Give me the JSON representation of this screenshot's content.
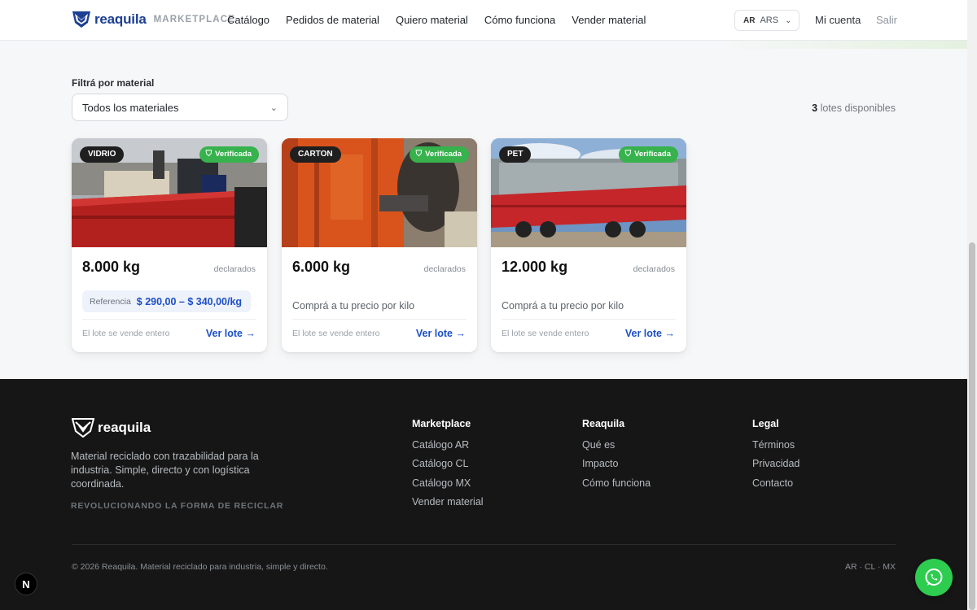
{
  "header": {
    "brand": "reaquila",
    "tagline": "MARKETPLACE",
    "nav": [
      "Catálogo",
      "Pedidos de material",
      "Quiero material",
      "Cómo funciona",
      "Vender material"
    ],
    "country_code": "AR",
    "currency": "ARS",
    "account": "Mi cuenta",
    "logout": "Salir"
  },
  "filter": {
    "label": "Filtrá por material",
    "selected": "Todos los materiales"
  },
  "results": {
    "count": "3",
    "suffix": "lotes disponibles"
  },
  "cards": [
    {
      "material": "VIDRIO",
      "verified": "Verificada",
      "weight": "8.000 kg",
      "declared": "declarados",
      "ref_label": "Referencia",
      "ref_range": "$ 290,00 – $ 340,00/kg",
      "whole": "El lote se vende entero",
      "cta": "Ver lote"
    },
    {
      "material": "CARTON",
      "verified": "Verificada",
      "weight": "6.000 kg",
      "declared": "declarados",
      "buy_text": "Comprá a tu precio por kilo",
      "whole": "El lote se vende entero",
      "cta": "Ver lote"
    },
    {
      "material": "PET",
      "verified": "Verificada",
      "weight": "12.000 kg",
      "declared": "declarados",
      "buy_text": "Comprá a tu precio por kilo",
      "whole": "El lote se vende entero",
      "cta": "Ver lote"
    }
  ],
  "footer": {
    "brand": "reaquila",
    "description": "Material reciclado con trazabilidad para la industria. Simple, directo y con logística coordinada.",
    "slogan": "REVOLUCIONANDO LA FORMA DE RECICLAR",
    "columns": [
      {
        "title": "Marketplace",
        "links": [
          "Catálogo AR",
          "Catálogo CL",
          "Catálogo MX",
          "Vender material"
        ]
      },
      {
        "title": "Reaquila",
        "links": [
          "Qué es",
          "Impacto",
          "Cómo funciona"
        ]
      },
      {
        "title": "Legal",
        "links": [
          "Términos",
          "Privacidad",
          "Contacto"
        ]
      }
    ],
    "copyright": "© 2026 Reaquila. Material reciclado para industria, simple y directo.",
    "regions": "AR · CL · MX"
  },
  "floating": {
    "dev_badge": "N"
  },
  "icons": {
    "logo": "eagle-shield-logo-icon",
    "verified": "shield-check-icon",
    "arrow": "arrow-right-icon",
    "chevron": "chevron-down-icon",
    "whatsapp": "whatsapp-icon"
  },
  "colors": {
    "brand_blue": "#1c3f94",
    "link_blue": "#1d4fc6",
    "verified_green": "#37b24d",
    "whatsapp_green": "#2ecc4f",
    "footer_bg": "#161616"
  }
}
